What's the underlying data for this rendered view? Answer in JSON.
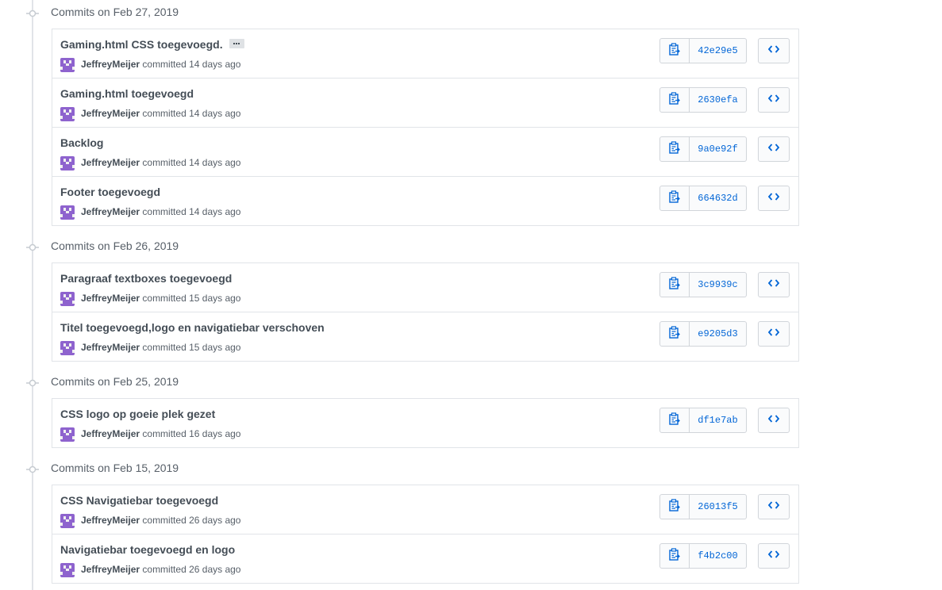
{
  "colors": {
    "accent": "#0366d6",
    "avatar": "#8e63ce",
    "border": "#e1e4e8"
  },
  "icons": {
    "timeline_node": "git-commit-icon",
    "copy": "clippy-icon",
    "browse": "code-icon",
    "avatar": "identicon"
  },
  "groups": [
    {
      "title": "Commits on Feb 27, 2019",
      "commits": [
        {
          "message": "Gaming.html CSS toegevoegd.",
          "has_more": true,
          "author": "JeffreyMeijer",
          "verb": "committed",
          "time": "14 days ago",
          "sha": "42e29e5"
        },
        {
          "message": "Gaming.html toegevoegd",
          "has_more": false,
          "author": "JeffreyMeijer",
          "verb": "committed",
          "time": "14 days ago",
          "sha": "2630efa"
        },
        {
          "message": "Backlog",
          "has_more": false,
          "author": "JeffreyMeijer",
          "verb": "committed",
          "time": "14 days ago",
          "sha": "9a0e92f"
        },
        {
          "message": "Footer toegevoegd",
          "has_more": false,
          "author": "JeffreyMeijer",
          "verb": "committed",
          "time": "14 days ago",
          "sha": "664632d"
        }
      ]
    },
    {
      "title": "Commits on Feb 26, 2019",
      "commits": [
        {
          "message": "Paragraaf textboxes toegevoegd",
          "has_more": false,
          "author": "JeffreyMeijer",
          "verb": "committed",
          "time": "15 days ago",
          "sha": "3c9939c"
        },
        {
          "message": "Titel toegevoegd,logo en navigatiebar verschoven",
          "has_more": false,
          "author": "JeffreyMeijer",
          "verb": "committed",
          "time": "15 days ago",
          "sha": "e9205d3"
        }
      ]
    },
    {
      "title": "Commits on Feb 25, 2019",
      "commits": [
        {
          "message": "CSS logo op goeie plek gezet",
          "has_more": false,
          "author": "JeffreyMeijer",
          "verb": "committed",
          "time": "16 days ago",
          "sha": "df1e7ab"
        }
      ]
    },
    {
      "title": "Commits on Feb 15, 2019",
      "commits": [
        {
          "message": "CSS Navigatiebar toegevoegd",
          "has_more": false,
          "author": "JeffreyMeijer",
          "verb": "committed",
          "time": "26 days ago",
          "sha": "26013f5"
        },
        {
          "message": "Navigatiebar toegevoegd en logo",
          "has_more": false,
          "author": "JeffreyMeijer",
          "verb": "committed",
          "time": "26 days ago",
          "sha": "f4b2c00"
        }
      ]
    }
  ]
}
